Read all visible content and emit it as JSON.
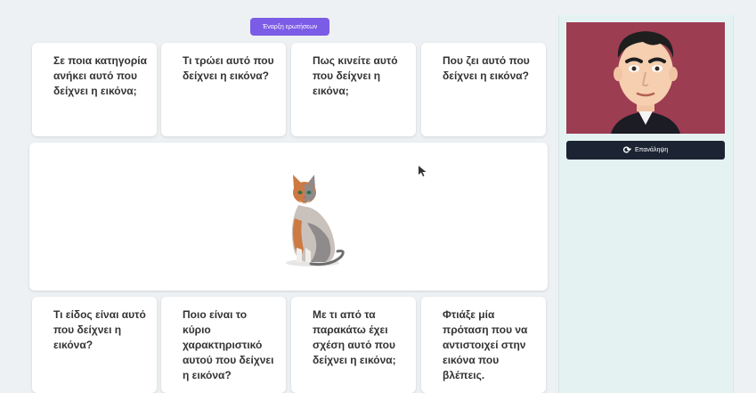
{
  "toolbar": {
    "start_label": "Έναρξη ερωτήσεων"
  },
  "questions": [
    "Σε ποια κατηγορία ανήκει αυτό που δείχνει η εικόνα;",
    "Τι τρώει αυτό που δείχνει η εικόνα?",
    "Πως κινείτε αυτό που δείχνει η εικόνα;",
    "Που ζει αυτό που δείχνει η εικόνα?",
    "Τι είδος είναι αυτό που δείχνει η εικόνα?",
    "Ποιο είναι το κύριο χαρακτηριστικό αυτού που δείχνει η εικόνα?",
    "Με τι από τα παρακάτω έχει σχέση αυτό που δείχνει η εικόνα;",
    "Φτιάξε μία πρόταση που να αντιστοιχεί στην εικόνα που βλέπεις."
  ],
  "image_panel": {
    "icon": "cat-illustration"
  },
  "avatar": {
    "icon": "presenter-avatar",
    "background": "#9c3d52"
  },
  "repeat": {
    "label": "Επανάληψη",
    "icon": "rotate-icon"
  },
  "colors": {
    "accent": "#7b5ce6",
    "dark_button": "#1c2433",
    "panel_bg": "#e4f3f2"
  }
}
